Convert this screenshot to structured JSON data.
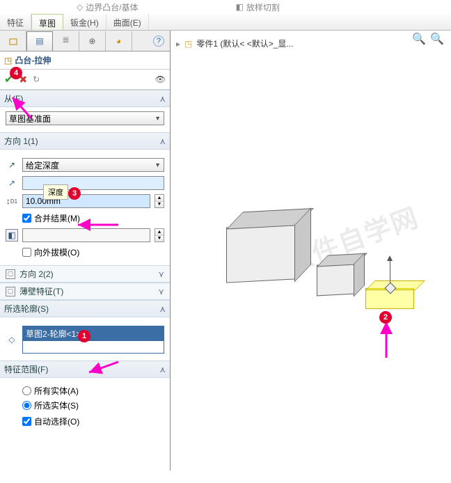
{
  "top": {
    "cmd_boundary": "边界凸台/基体",
    "cmd_sweepcut": "放样切割"
  },
  "menu": {
    "feature": "特征",
    "sketch": "草图",
    "sheetmetal": "钣金(H)",
    "surface": "曲面(E)"
  },
  "feature": {
    "title": "凸台-拉伸"
  },
  "sections": {
    "from": {
      "label": "从(F)",
      "value": "草图基准面"
    },
    "dir1": {
      "label": "方向 1(1)",
      "mode": "给定深度",
      "depth_tooltip": "深度",
      "depth_value": "10.00mm",
      "merge": "合并结果(M)",
      "draft": "向外拔模(O)"
    },
    "dir2": {
      "label": "方向 2(2)"
    },
    "thin": {
      "label": "薄壁特征(T)"
    },
    "contours": {
      "label": "所选轮廓(S)",
      "item": "草图2-轮廓<1>"
    },
    "scope": {
      "label": "特征范围(F)",
      "all": "所有实体(A)",
      "selected": "所选实体(S)",
      "auto": "自动选择(O)"
    }
  },
  "viewport": {
    "crumb": "零件1  (默认< <默认>_显..."
  },
  "annotations": {
    "a1": "1",
    "a2": "2",
    "a3": "3",
    "a4": "4"
  }
}
